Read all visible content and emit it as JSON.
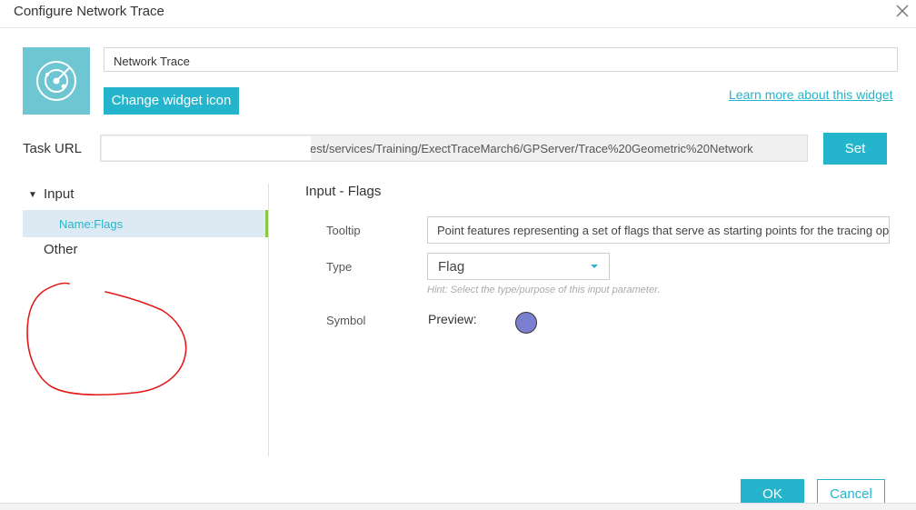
{
  "dialog": {
    "title": "Configure Network Trace",
    "close_icon": "close-icon"
  },
  "widget": {
    "icon": "radar-icon",
    "name_value": "Network Trace",
    "change_icon_label": "Change widget icon",
    "learn_more_label": "Learn more about this widget"
  },
  "task": {
    "label": "Task URL",
    "url_value": "est/services/Training/ExectTraceMarch6/GPServer/Trace%20Geometric%20Network",
    "set_label": "Set"
  },
  "tree": {
    "groups": [
      {
        "label": "Input",
        "expanded": true,
        "items": [
          {
            "label": "Name:Flags",
            "selected": true
          }
        ]
      },
      {
        "label": "Other",
        "expanded": false,
        "items": []
      }
    ]
  },
  "detail": {
    "section_title": "Input - Flags",
    "tooltip_label": "Tooltip",
    "tooltip_value": "Point features representing a set of flags that serve as starting points for the tracing operat",
    "type_label": "Type",
    "type_value": "Flag",
    "type_hint": "Hint: Select the type/purpose of this input parameter.",
    "symbol_label": "Symbol",
    "preview_label": "Preview:",
    "symbol_color": "#7b7fd0"
  },
  "footer": {
    "ok_label": "OK",
    "cancel_label": "Cancel"
  },
  "colors": {
    "accent": "#24b5cc",
    "icon_bg": "#6ec6d2",
    "selected_bg": "#deeaf3",
    "selected_bar": "#8dc63f",
    "annotation": "#e11b1b"
  }
}
